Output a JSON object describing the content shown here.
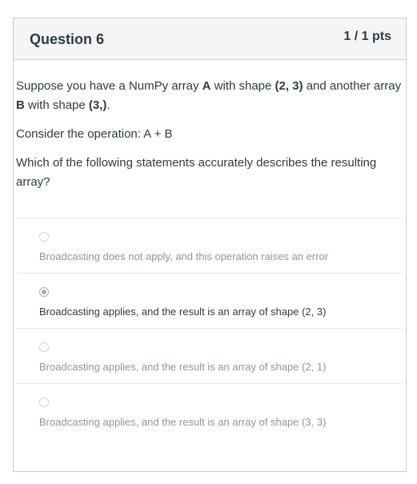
{
  "question": {
    "title": "Question 6",
    "points": "1 / 1 pts",
    "paragraph1": {
      "t1": "Suppose you have a NumPy array ",
      "b1": "A",
      "t2": " with shape ",
      "b2": "(2, 3)",
      "t3": " and another array ",
      "b3": "B",
      "t4": " with shape ",
      "b4": "(3,)",
      "t5": "."
    },
    "paragraph2": "Consider the operation: A + B",
    "paragraph3": "Which of the following statements accurately describes the resulting array?"
  },
  "answers": [
    {
      "label": "Broadcasting does not apply, and this operation raises an error",
      "selected": false
    },
    {
      "label": "Broadcasting applies, and the result is an array of shape (2, 3)",
      "selected": true
    },
    {
      "label": "Broadcasting applies, and the result is an array of shape (2, 1)",
      "selected": false
    },
    {
      "label": "Broadcasting applies, and the result is an array of shape (3, 3)",
      "selected": false
    }
  ],
  "colors": {
    "text": "#2d3b45",
    "muted": "#8b969e",
    "header_bg": "#f5f5f5",
    "border": "#c7cdd1"
  }
}
